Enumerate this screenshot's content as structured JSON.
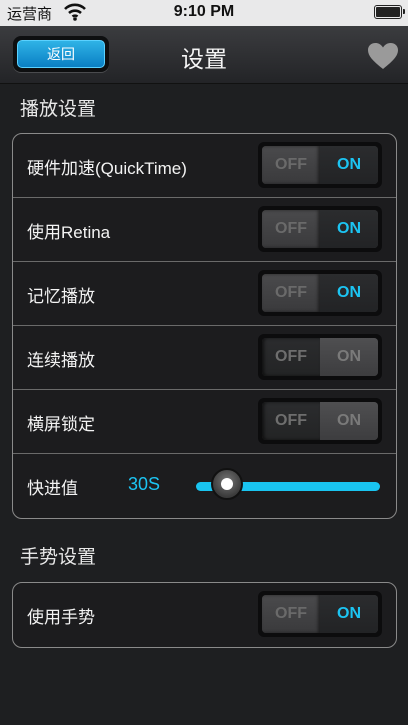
{
  "status_bar": {
    "carrier": "运营商",
    "time": "9:10 PM"
  },
  "nav": {
    "back_label": "返回",
    "title": "设置"
  },
  "playback_section": {
    "title": "播放设置",
    "rows": [
      {
        "label": "硬件加速(QuickTime)",
        "off": "OFF",
        "on": "ON",
        "state": "on"
      },
      {
        "label": "使用Retina",
        "off": "OFF",
        "on": "ON",
        "state": "on"
      },
      {
        "label": "记忆播放",
        "off": "OFF",
        "on": "ON",
        "state": "on"
      },
      {
        "label": "连续播放",
        "off": "OFF",
        "on": "ON",
        "state": "off"
      },
      {
        "label": "横屏锁定",
        "off": "OFF",
        "on": "ON",
        "state": "off"
      }
    ],
    "fast_forward": {
      "label": "快进值",
      "value": "30S",
      "position": 0.2
    }
  },
  "gesture_section": {
    "title": "手势设置",
    "rows": [
      {
        "label": "使用手势",
        "off": "OFF",
        "on": "ON",
        "state": "on"
      }
    ]
  },
  "colors": {
    "accent": "#1cc4f2",
    "background": "#1e1f21"
  }
}
